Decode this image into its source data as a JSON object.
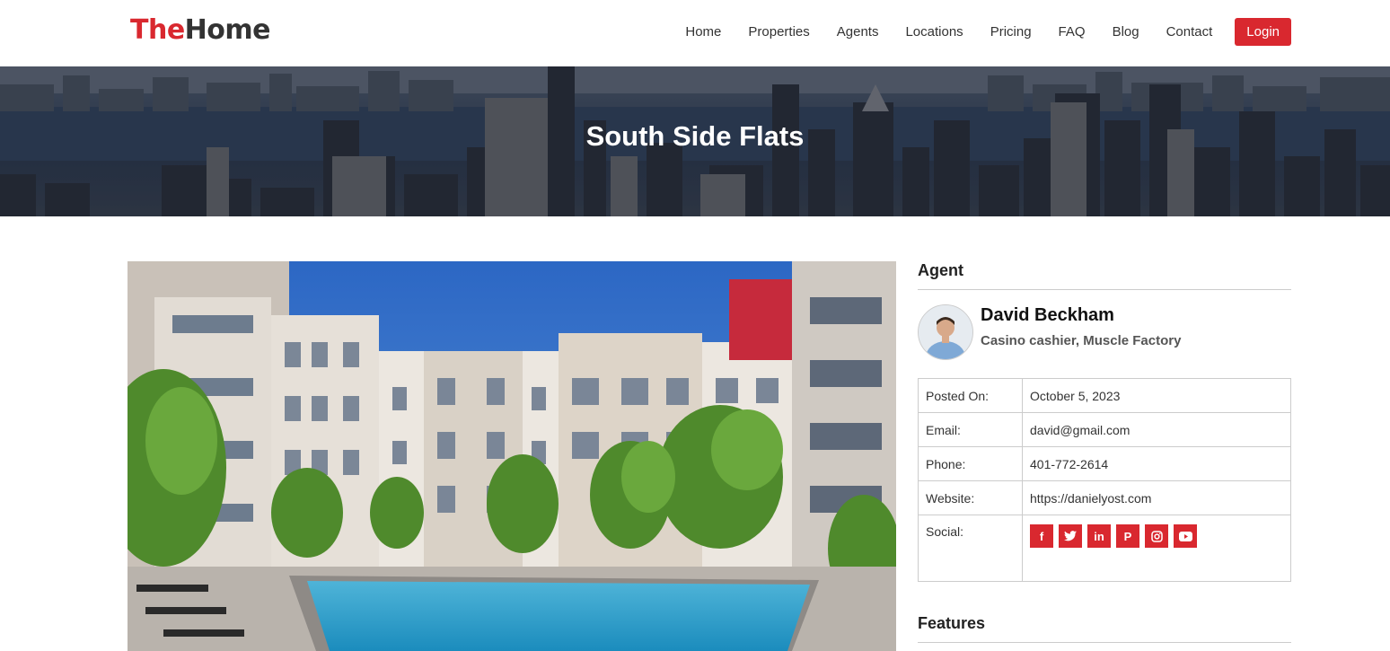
{
  "brand": {
    "part1": "The",
    "part2": "Home"
  },
  "nav": {
    "items": [
      "Home",
      "Properties",
      "Agents",
      "Locations",
      "Pricing",
      "FAQ",
      "Blog",
      "Contact"
    ],
    "login": "Login"
  },
  "banner": {
    "title": "South Side Flats"
  },
  "colors": {
    "accent": "#d9282f"
  },
  "sidebar": {
    "agent_heading": "Agent",
    "agent": {
      "name": "David Beckham",
      "role": "Casino cashier, Muscle Factory"
    },
    "rows": [
      {
        "label": "Posted On:",
        "value": "October 5, 2023"
      },
      {
        "label": "Email:",
        "value": "david@gmail.com"
      },
      {
        "label": "Phone:",
        "value": "401-772-2614"
      },
      {
        "label": "Website:",
        "value": "https://danielyost.com"
      }
    ],
    "social_label": "Social:",
    "social_icons": [
      "facebook-icon",
      "twitter-icon",
      "linkedin-icon",
      "pinterest-icon",
      "instagram-icon",
      "youtube-icon"
    ],
    "features_heading": "Features"
  }
}
